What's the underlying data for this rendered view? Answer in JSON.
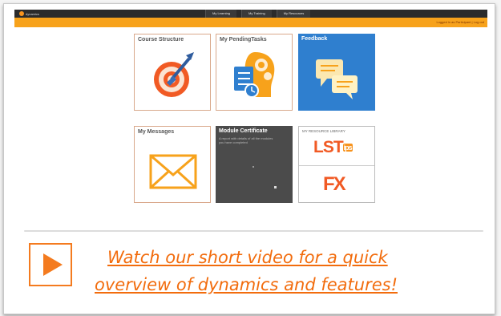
{
  "header": {
    "logo_text": "dynamics",
    "nav": [
      "My Learning",
      "My Training",
      "My Resources"
    ],
    "account_links": "Logged in as Participant | Log out"
  },
  "tiles": {
    "course_structure": "Course Structure",
    "pending_tasks": "My PendingTasks",
    "feedback": "Feedback",
    "messages": "My Messages",
    "certificate": "Module Certificate",
    "certificate_desc": "A report with details of all the modules you have completed",
    "resource_library": "MY RESOURCE LIBRARY",
    "lst_main": "LST",
    "lst_suffix": "ips",
    "fx": "FX"
  },
  "video": {
    "line1": "Watch our short video for a quick",
    "line2": "overview of dynamics and features!"
  },
  "colors": {
    "accent_orange": "#f7a21b",
    "link_orange": "#f26c0d",
    "feedback_blue": "#2f7fcf",
    "certificate_gray": "#4b4b4b"
  }
}
